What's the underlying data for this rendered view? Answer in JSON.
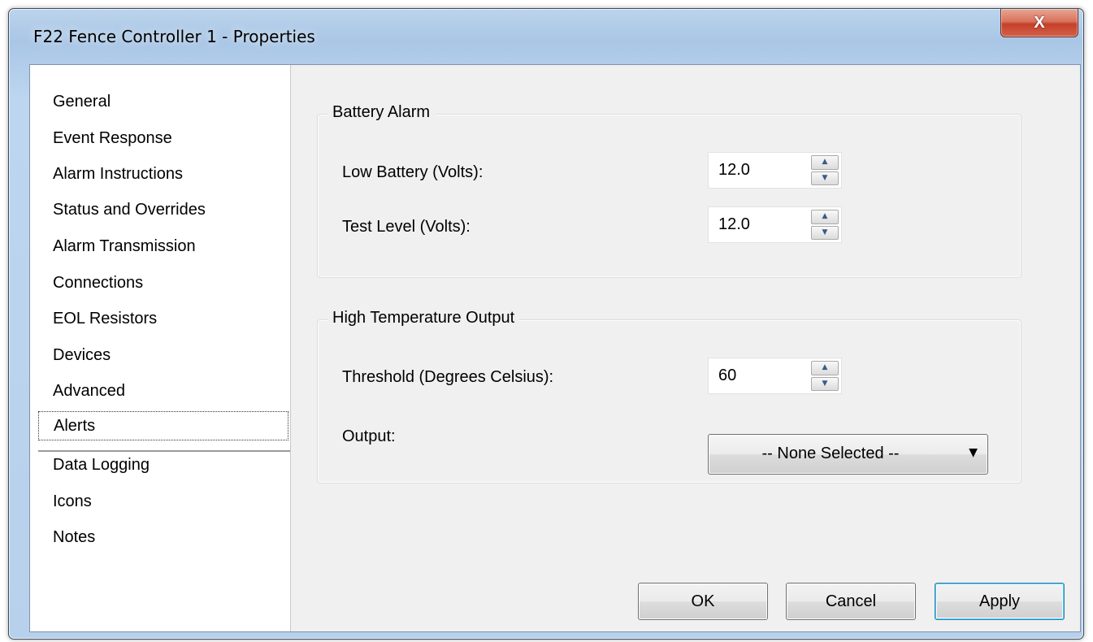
{
  "window": {
    "title": "F22 Fence Controller 1 - Properties",
    "close_label": "X"
  },
  "sidebar": {
    "items": [
      {
        "label": "General"
      },
      {
        "label": "Event Response"
      },
      {
        "label": "Alarm Instructions"
      },
      {
        "label": "Status and Overrides"
      },
      {
        "label": "Alarm Transmission"
      },
      {
        "label": "Connections"
      },
      {
        "label": "EOL Resistors"
      },
      {
        "label": "Devices"
      },
      {
        "label": "Advanced"
      },
      {
        "label": "Alerts",
        "selected": true
      },
      {
        "label": "Data Logging"
      },
      {
        "label": "Icons"
      },
      {
        "label": "Notes"
      }
    ]
  },
  "battery_alarm": {
    "legend": "Battery Alarm",
    "low_battery_label": "Low Battery (Volts):",
    "low_battery_value": "12.0",
    "test_level_label": "Test Level (Volts):",
    "test_level_value": "12.0"
  },
  "high_temp": {
    "legend": "High Temperature Output",
    "threshold_label": "Threshold (Degrees Celsius):",
    "threshold_value": "60",
    "output_label": "Output:",
    "output_value": "-- None Selected --"
  },
  "buttons": {
    "ok": "OK",
    "cancel": "Cancel",
    "apply": "Apply"
  },
  "icons": {
    "spin_up": "arrow-up-icon",
    "spin_down": "arrow-down-icon",
    "dropdown": "chevron-down-icon"
  }
}
